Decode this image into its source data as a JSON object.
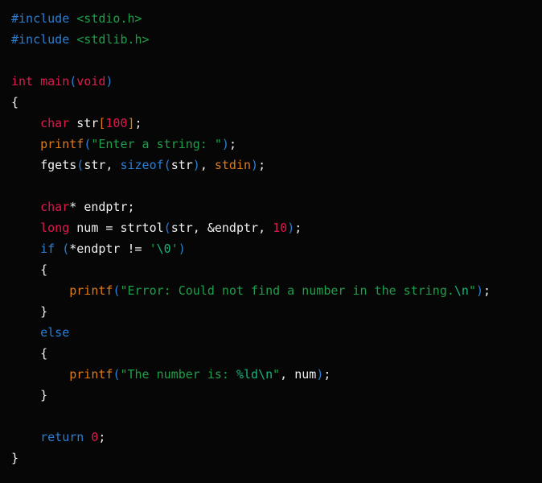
{
  "editor": {
    "language": "C",
    "background_color": "#060606",
    "default_text_color": "#f0f0f0",
    "font_size_px": 15,
    "line_height_px": 26,
    "indent_spaces": 4
  },
  "palette": {
    "preprocessor": "#2a7fd4",
    "header": "#1f9e4a",
    "keyword_type": "#e0194f",
    "keyword_control": "#2a7fd4",
    "function_builtin": "#e07b18",
    "string": "#1f9e4a",
    "escape": "#18b37a",
    "number": "#e0194f",
    "paren": "#2a7fd4",
    "bracket": "#e07b18",
    "identifier": "#f0f0f0",
    "constant": "#e07b18"
  },
  "code": {
    "title": "C source code",
    "plain_text": "#include <stdio.h>\n#include <stdlib.h>\n\nint main(void)\n{\n    char str[100];\n    printf(\"Enter a string: \");\n    fgets(str, sizeof(str), stdin);\n\n    char* endptr;\n    long num = strtol(str, &endptr, 10);\n    if (*endptr != '\\0')\n    {\n        printf(\"Error: Could not find a number in the string.\\n\");\n    }\n    else\n    {\n        printf(\"The number is: %ld\\n\", num);\n    }\n\n    return 0;\n}",
    "lines": [
      {
        "n": 1,
        "tokens": [
          {
            "t": "#include",
            "c": "t-pre"
          },
          {
            "t": " ",
            "c": "t-plain"
          },
          {
            "t": "<stdio.h>",
            "c": "t-header"
          }
        ]
      },
      {
        "n": 2,
        "tokens": [
          {
            "t": "#include",
            "c": "t-pre"
          },
          {
            "t": " ",
            "c": "t-plain"
          },
          {
            "t": "<stdlib.h>",
            "c": "t-header"
          }
        ]
      },
      {
        "n": 3,
        "tokens": []
      },
      {
        "n": 4,
        "tokens": [
          {
            "t": "int",
            "c": "t-type"
          },
          {
            "t": " ",
            "c": "t-plain"
          },
          {
            "t": "main",
            "c": "t-fnmain"
          },
          {
            "t": "(",
            "c": "t-paren"
          },
          {
            "t": "void",
            "c": "t-type"
          },
          {
            "t": ")",
            "c": "t-paren"
          }
        ]
      },
      {
        "n": 5,
        "tokens": [
          {
            "t": "{",
            "c": "t-brace"
          }
        ]
      },
      {
        "n": 6,
        "tokens": [
          {
            "t": "    ",
            "c": "t-plain"
          },
          {
            "t": "char",
            "c": "t-type"
          },
          {
            "t": " ",
            "c": "t-plain"
          },
          {
            "t": "str",
            "c": "t-ident"
          },
          {
            "t": "[",
            "c": "t-bracket"
          },
          {
            "t": "100",
            "c": "t-num"
          },
          {
            "t": "]",
            "c": "t-bracket"
          },
          {
            "t": ";",
            "c": "t-punct"
          }
        ]
      },
      {
        "n": 7,
        "tokens": [
          {
            "t": "    ",
            "c": "t-plain"
          },
          {
            "t": "printf",
            "c": "t-fn"
          },
          {
            "t": "(",
            "c": "t-paren"
          },
          {
            "t": "\"Enter a string: \"",
            "c": "t-str"
          },
          {
            "t": ")",
            "c": "t-paren"
          },
          {
            "t": ";",
            "c": "t-punct"
          }
        ]
      },
      {
        "n": 8,
        "tokens": [
          {
            "t": "    ",
            "c": "t-plain"
          },
          {
            "t": "fgets",
            "c": "t-ident"
          },
          {
            "t": "(",
            "c": "t-paren"
          },
          {
            "t": "str",
            "c": "t-ident"
          },
          {
            "t": ", ",
            "c": "t-punct"
          },
          {
            "t": "sizeof",
            "c": "t-kw2"
          },
          {
            "t": "(",
            "c": "t-paren"
          },
          {
            "t": "str",
            "c": "t-ident"
          },
          {
            "t": ")",
            "c": "t-paren"
          },
          {
            "t": ", ",
            "c": "t-punct"
          },
          {
            "t": "stdin",
            "c": "t-const"
          },
          {
            "t": ")",
            "c": "t-paren"
          },
          {
            "t": ";",
            "c": "t-punct"
          }
        ]
      },
      {
        "n": 9,
        "tokens": []
      },
      {
        "n": 10,
        "tokens": [
          {
            "t": "    ",
            "c": "t-plain"
          },
          {
            "t": "char",
            "c": "t-type"
          },
          {
            "t": "*",
            "c": "t-op"
          },
          {
            "t": " ",
            "c": "t-plain"
          },
          {
            "t": "endptr",
            "c": "t-ident"
          },
          {
            "t": ";",
            "c": "t-punct"
          }
        ]
      },
      {
        "n": 11,
        "tokens": [
          {
            "t": "    ",
            "c": "t-plain"
          },
          {
            "t": "long",
            "c": "t-type"
          },
          {
            "t": " ",
            "c": "t-plain"
          },
          {
            "t": "num",
            "c": "t-ident"
          },
          {
            "t": " = ",
            "c": "t-op"
          },
          {
            "t": "strtol",
            "c": "t-ident"
          },
          {
            "t": "(",
            "c": "t-paren"
          },
          {
            "t": "str",
            "c": "t-ident"
          },
          {
            "t": ", ",
            "c": "t-punct"
          },
          {
            "t": "&endptr",
            "c": "t-ident"
          },
          {
            "t": ", ",
            "c": "t-punct"
          },
          {
            "t": "10",
            "c": "t-num"
          },
          {
            "t": ")",
            "c": "t-paren"
          },
          {
            "t": ";",
            "c": "t-punct"
          }
        ]
      },
      {
        "n": 12,
        "tokens": [
          {
            "t": "    ",
            "c": "t-plain"
          },
          {
            "t": "if",
            "c": "t-kw2"
          },
          {
            "t": " ",
            "c": "t-plain"
          },
          {
            "t": "(",
            "c": "t-paren"
          },
          {
            "t": "*endptr",
            "c": "t-ident"
          },
          {
            "t": " != ",
            "c": "t-op"
          },
          {
            "t": "'",
            "c": "t-str"
          },
          {
            "t": "\\0",
            "c": "t-esc"
          },
          {
            "t": "'",
            "c": "t-str"
          },
          {
            "t": ")",
            "c": "t-paren"
          }
        ]
      },
      {
        "n": 13,
        "tokens": [
          {
            "t": "    ",
            "c": "t-plain"
          },
          {
            "t": "{",
            "c": "t-brace"
          }
        ]
      },
      {
        "n": 14,
        "tokens": [
          {
            "t": "        ",
            "c": "t-plain"
          },
          {
            "t": "printf",
            "c": "t-fn"
          },
          {
            "t": "(",
            "c": "t-paren"
          },
          {
            "t": "\"Error: Could not find a number in the string.",
            "c": "t-str"
          },
          {
            "t": "\\n",
            "c": "t-esc"
          },
          {
            "t": "\"",
            "c": "t-str"
          },
          {
            "t": ")",
            "c": "t-paren"
          },
          {
            "t": ";",
            "c": "t-punct"
          }
        ]
      },
      {
        "n": 15,
        "tokens": [
          {
            "t": "    ",
            "c": "t-plain"
          },
          {
            "t": "}",
            "c": "t-brace"
          }
        ]
      },
      {
        "n": 16,
        "tokens": [
          {
            "t": "    ",
            "c": "t-plain"
          },
          {
            "t": "else",
            "c": "t-kw2"
          }
        ]
      },
      {
        "n": 17,
        "tokens": [
          {
            "t": "    ",
            "c": "t-plain"
          },
          {
            "t": "{",
            "c": "t-brace"
          }
        ]
      },
      {
        "n": 18,
        "tokens": [
          {
            "t": "        ",
            "c": "t-plain"
          },
          {
            "t": "printf",
            "c": "t-fn"
          },
          {
            "t": "(",
            "c": "t-paren"
          },
          {
            "t": "\"The number is: ",
            "c": "t-str"
          },
          {
            "t": "%ld",
            "c": "t-esc"
          },
          {
            "t": "\\n",
            "c": "t-esc"
          },
          {
            "t": "\"",
            "c": "t-str"
          },
          {
            "t": ", ",
            "c": "t-punct"
          },
          {
            "t": "num",
            "c": "t-ident"
          },
          {
            "t": ")",
            "c": "t-paren"
          },
          {
            "t": ";",
            "c": "t-punct"
          }
        ]
      },
      {
        "n": 19,
        "tokens": [
          {
            "t": "    ",
            "c": "t-plain"
          },
          {
            "t": "}",
            "c": "t-brace"
          }
        ]
      },
      {
        "n": 20,
        "tokens": []
      },
      {
        "n": 21,
        "tokens": [
          {
            "t": "    ",
            "c": "t-plain"
          },
          {
            "t": "return",
            "c": "t-kw2"
          },
          {
            "t": " ",
            "c": "t-plain"
          },
          {
            "t": "0",
            "c": "t-num"
          },
          {
            "t": ";",
            "c": "t-punct"
          }
        ]
      },
      {
        "n": 22,
        "tokens": [
          {
            "t": "}",
            "c": "t-brace"
          }
        ]
      }
    ]
  }
}
